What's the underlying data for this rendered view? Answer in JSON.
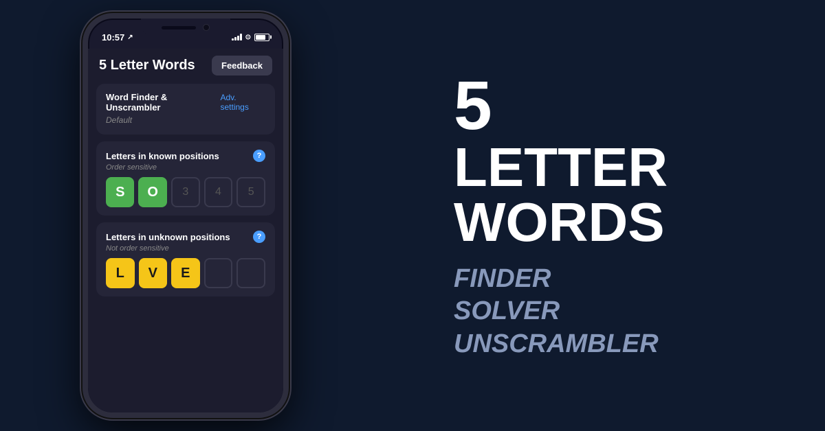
{
  "page": {
    "background_color": "#0f1a2e"
  },
  "phone": {
    "status_bar": {
      "time": "10:57",
      "location_icon": "↗",
      "battery_level": 80
    },
    "app": {
      "title": "5 Letter Words",
      "feedback_button": "Feedback",
      "word_finder": {
        "title": "Word Finder & Unscrambler",
        "link": "Adv. settings",
        "subtitle": "Default"
      },
      "known_positions": {
        "title": "Letters in known positions",
        "subtitle": "Order sensitive",
        "help": "?",
        "tiles": [
          {
            "letter": "S",
            "type": "green"
          },
          {
            "letter": "O",
            "type": "green"
          },
          {
            "letter": "3",
            "type": "empty"
          },
          {
            "letter": "4",
            "type": "empty"
          },
          {
            "letter": "5",
            "type": "empty"
          }
        ]
      },
      "unknown_positions": {
        "title": "Letters in unknown positions",
        "subtitle": "Not order sensitive",
        "help": "?",
        "tiles": [
          {
            "letter": "L",
            "type": "yellow"
          },
          {
            "letter": "V",
            "type": "yellow"
          },
          {
            "letter": "E",
            "type": "yellow"
          },
          {
            "letter": "",
            "type": "empty"
          },
          {
            "letter": "",
            "type": "empty"
          }
        ]
      }
    }
  },
  "headline": {
    "number": "5",
    "word1": "LETTER",
    "word2": "WORDS",
    "sub1": "FINDER",
    "sub2": "SOLVER",
    "sub3": "UNSCRAMBLER"
  }
}
